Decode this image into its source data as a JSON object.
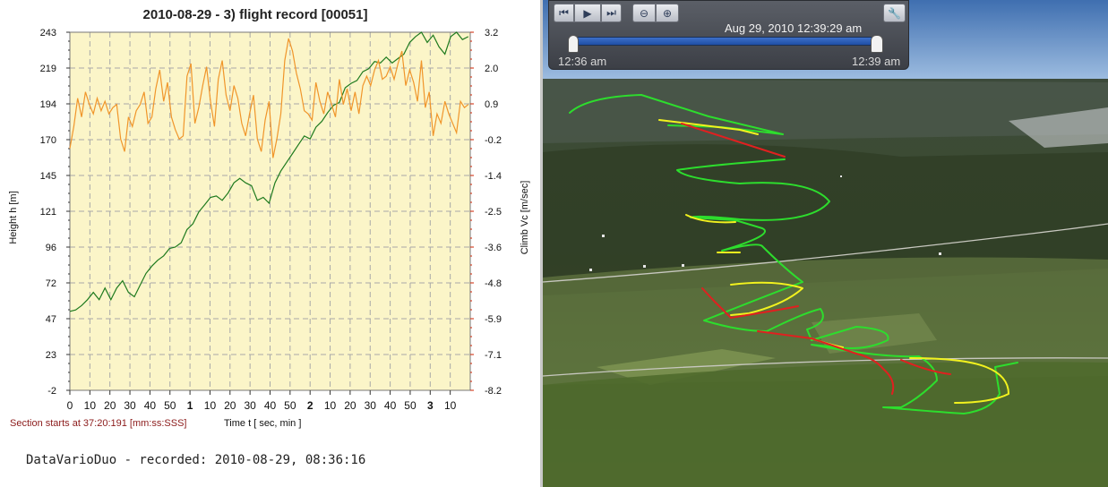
{
  "chart_title": "2010-08-29 - 3) flight record [00051]",
  "section_start": "Section starts at  37:20:191 [mm:ss:SSS]",
  "time_axis_label": "Time  t  [ sec, min ]",
  "recorded": "DataVarioDuo - recorded: 2010-08-29, 08:36:16",
  "colors": {
    "plot_bg": "#fbf5c8",
    "height_line": "#1e7a1e",
    "climb_line": "#f0952a",
    "climb_axis": "#cc2200",
    "grid": "#a8a8a8",
    "track_green": "#2ddd2d",
    "track_yellow": "#f2f21e",
    "track_red": "#e02020"
  },
  "map": {
    "current_time": "Aug 29, 2010  12:39:29 am",
    "start_time": "12:36 am",
    "end_time": "12:39 am",
    "buttons": {
      "back": "⏮",
      "play": "▶",
      "forward": "⏭",
      "zoom_out": "⊖",
      "zoom_in": "⊕",
      "settings": "🔧"
    },
    "icons": [
      "skip-back-icon",
      "play-icon",
      "skip-forward-icon",
      "zoom-out-icon",
      "zoom-in-icon",
      "wrench-icon"
    ]
  },
  "chart_data": {
    "type": "line",
    "title": "2010-08-29 - 3) flight record [00051]",
    "xlabel": "Time  t  [ sec, min ]",
    "x_ticks": [
      "0",
      "10",
      "20",
      "30",
      "40",
      "50",
      "1",
      "10",
      "20",
      "30",
      "40",
      "50",
      "2",
      "10",
      "20",
      "30",
      "40",
      "50",
      "3",
      "10"
    ],
    "bold_x_ticks": [
      "1",
      "2",
      "3"
    ],
    "left_axis": {
      "label": "Height   h   [m]",
      "ylim": [
        -2,
        243
      ],
      "ticks": [
        "243",
        "219",
        "194",
        "170",
        "145",
        "121",
        "96",
        "72",
        "47",
        "23",
        "-2"
      ]
    },
    "right_axis": {
      "label": "Climb   Vc   [m/sec]",
      "ylim": [
        -8.2,
        3.2
      ],
      "ticks": [
        "3.2",
        "2.0",
        "0.9",
        "-0.2",
        "-1.4",
        "-2.5",
        "-3.6",
        "-4.8",
        "-5.9",
        "-7.1",
        "-8.2"
      ]
    },
    "xlim": [
      0,
      205
    ],
    "series": [
      {
        "axis": "left",
        "x": [
          0,
          3,
          6,
          9,
          12,
          15,
          18,
          21,
          24,
          27,
          30,
          33,
          36,
          39,
          42,
          45,
          48,
          51,
          54,
          57,
          60,
          63,
          66,
          69,
          72,
          75,
          78,
          81,
          84,
          87,
          90,
          93,
          96,
          99,
          102,
          105,
          108,
          111,
          114,
          117,
          120,
          123,
          126,
          129,
          132,
          135,
          138,
          141,
          144,
          147,
          150,
          153,
          156,
          159,
          162,
          165,
          168,
          171,
          174,
          177,
          180,
          183,
          186,
          189,
          192,
          195,
          198,
          201,
          204
        ],
        "values": [
          52,
          53,
          56,
          60,
          65,
          60,
          68,
          60,
          68,
          73,
          65,
          62,
          70,
          78,
          83,
          87,
          90,
          95,
          96,
          99,
          108,
          112,
          120,
          125,
          130,
          131,
          128,
          133,
          140,
          143,
          140,
          138,
          128,
          130,
          126,
          140,
          148,
          154,
          160,
          166,
          172,
          170,
          178,
          182,
          188,
          193,
          195,
          205,
          208,
          210,
          216,
          218,
          223,
          222,
          226,
          222,
          225,
          228,
          236,
          240,
          243,
          236,
          241,
          233,
          228,
          240,
          243,
          238,
          240
        ]
      },
      {
        "axis": "right",
        "x": [
          0,
          2,
          4,
          6,
          8,
          10,
          12,
          14,
          16,
          18,
          20,
          22,
          24,
          26,
          28,
          30,
          32,
          34,
          36,
          38,
          40,
          42,
          44,
          46,
          48,
          50,
          52,
          54,
          56,
          58,
          60,
          62,
          64,
          66,
          68,
          70,
          72,
          74,
          76,
          78,
          80,
          82,
          84,
          86,
          88,
          90,
          92,
          94,
          96,
          98,
          100,
          102,
          104,
          106,
          108,
          110,
          112,
          114,
          116,
          118,
          120,
          122,
          124,
          126,
          128,
          130,
          132,
          134,
          136,
          138,
          140,
          142,
          144,
          146,
          148,
          150,
          152,
          154,
          156,
          158,
          160,
          162,
          164,
          166,
          168,
          170,
          172,
          174,
          176,
          178,
          180,
          182,
          184,
          186,
          188,
          190,
          192,
          194,
          196,
          198,
          200,
          202,
          204
        ],
        "values": [
          -0.5,
          0.2,
          1.1,
          0.5,
          1.3,
          0.9,
          0.6,
          1.1,
          0.7,
          1.0,
          0.6,
          0.8,
          0.9,
          -0.2,
          -0.6,
          0.5,
          0.2,
          0.7,
          0.9,
          1.3,
          0.3,
          0.5,
          1.4,
          2.0,
          1.0,
          1.6,
          0.5,
          0.1,
          -0.2,
          -0.1,
          1.8,
          2.2,
          0.3,
          0.8,
          1.5,
          2.1,
          1.0,
          0.2,
          1.7,
          2.3,
          1.2,
          0.7,
          1.5,
          1.1,
          0.3,
          -0.1,
          0.6,
          1.2,
          -0.2,
          -0.6,
          0.4,
          1.0,
          -0.8,
          -0.2,
          0.6,
          2.3,
          3.0,
          2.6,
          1.9,
          1.4,
          0.7,
          0.6,
          0.4,
          1.6,
          1.0,
          0.6,
          1.3,
          0.9,
          0.5,
          1.7,
          0.9,
          1.4,
          0.7,
          1.3,
          0.6,
          1.5,
          1.8,
          1.5,
          2.0,
          2.3,
          1.7,
          1.8,
          2.1,
          1.7,
          2.2,
          2.6,
          1.5,
          2.0,
          1.6,
          1.0,
          2.3,
          0.8,
          1.3,
          -0.1,
          0.6,
          0.3,
          1.0,
          0.6,
          0.3,
          0.0,
          1.0,
          0.8,
          0.9
        ]
      }
    ]
  }
}
